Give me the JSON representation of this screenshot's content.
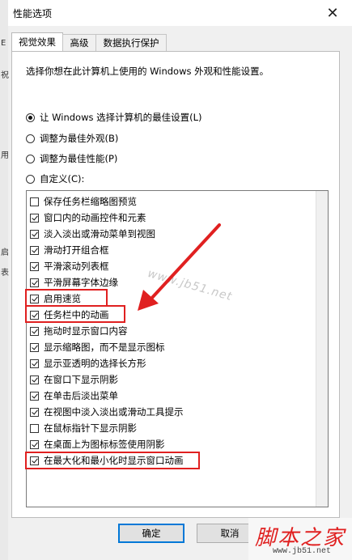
{
  "window": {
    "title": "性能选项",
    "close_glyph": "✕",
    "left_strip_chars": [
      "E",
      "祝",
      "用",
      "启",
      "表"
    ]
  },
  "tabs": [
    {
      "label": "视觉效果",
      "active": true
    },
    {
      "label": "高级",
      "active": false
    },
    {
      "label": "数据执行保护",
      "active": false
    }
  ],
  "visual": {
    "description": "选择你想在此计算机上使用的 Windows 外观和性能设置。",
    "radios": [
      {
        "label": "让 Windows 选择计算机的最佳设置(L)",
        "checked": true
      },
      {
        "label": "调整为最佳外观(B)",
        "checked": false
      },
      {
        "label": "调整为最佳性能(P)",
        "checked": false
      },
      {
        "label": "自定义(C):",
        "checked": false
      }
    ],
    "options": [
      {
        "label": "保存任务栏缩略图预览",
        "checked": false
      },
      {
        "label": "窗口内的动画控件和元素",
        "checked": true
      },
      {
        "label": "淡入淡出或滑动菜单到视图",
        "checked": true
      },
      {
        "label": "滑动打开组合框",
        "checked": true
      },
      {
        "label": "平滑滚动列表框",
        "checked": true
      },
      {
        "label": "平滑屏幕字体边缘",
        "checked": true
      },
      {
        "label": "启用速览",
        "checked": true
      },
      {
        "label": "任务栏中的动画",
        "checked": true
      },
      {
        "label": "拖动时显示窗口内容",
        "checked": true
      },
      {
        "label": "显示缩略图，而不是显示图标",
        "checked": true
      },
      {
        "label": "显示亚透明的选择长方形",
        "checked": true
      },
      {
        "label": "在窗口下显示阴影",
        "checked": true
      },
      {
        "label": "在单击后淡出菜单",
        "checked": true
      },
      {
        "label": "在视图中淡入淡出或滑动工具提示",
        "checked": true
      },
      {
        "label": "在鼠标指针下显示阴影",
        "checked": false
      },
      {
        "label": "在桌面上为图标标签使用阴影",
        "checked": true
      },
      {
        "label": "在最大化和最小化时显示窗口动画",
        "checked": true
      }
    ]
  },
  "buttons": {
    "ok": "确定",
    "cancel": "取消"
  },
  "watermark": "www.jb51.net",
  "site_logo": {
    "name": "脚本之家",
    "url": "www.jb51.net"
  },
  "colors": {
    "highlight": "#e02020",
    "accent": "#0078d7"
  }
}
